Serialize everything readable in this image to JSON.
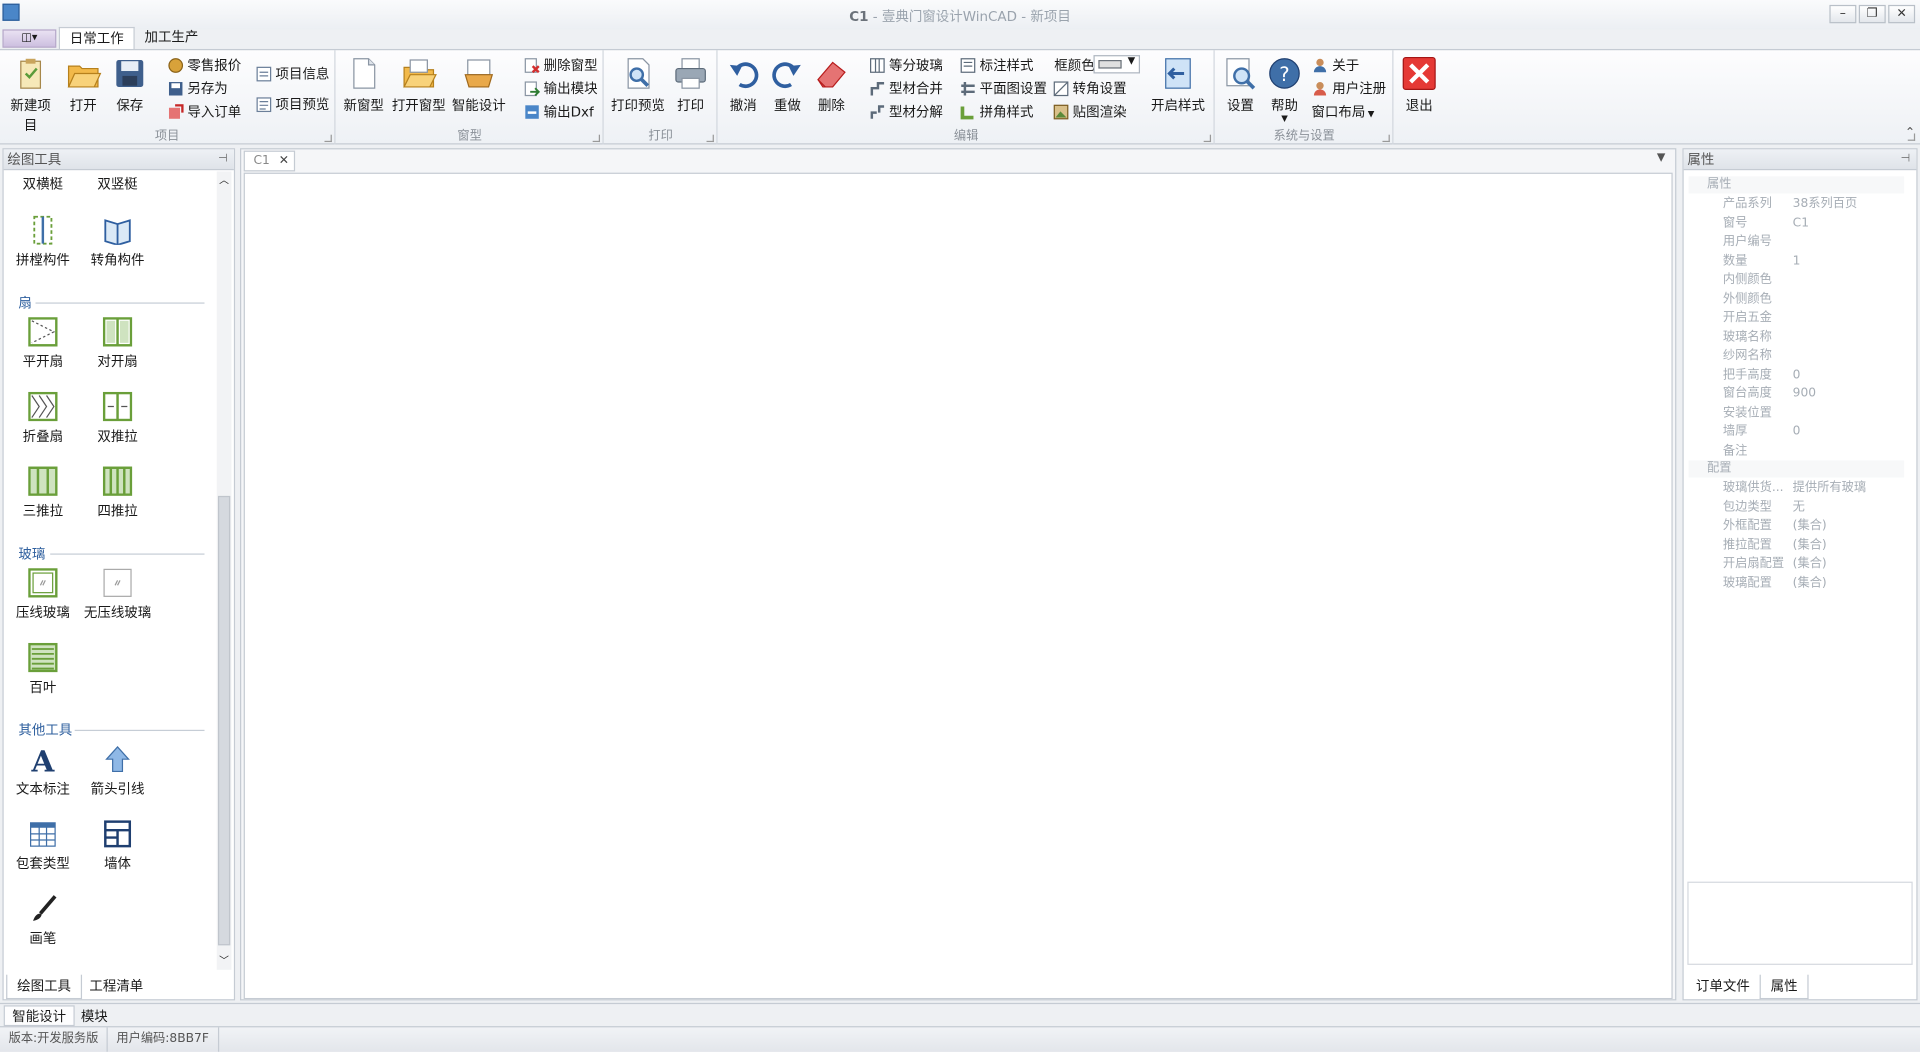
{
  "window": {
    "doc": "C1",
    "title_rest": " - 壹典门窗设计WinCAD - 新项目",
    "min": "–",
    "restore": "❐",
    "close": "✕"
  },
  "app_menu": "◫▾",
  "ribbon_tabs": [
    "日常工作",
    "加工生产"
  ],
  "groups": {
    "project": {
      "label": "项目",
      "new": "新建项目",
      "open": "打开",
      "save": "保存",
      "quote": "零售报价",
      "saveas": "另存为",
      "import": "导入订单",
      "info": "项目信息",
      "preview": "项目预览"
    },
    "window_type": {
      "label": "窗型",
      "new": "新窗型",
      "open": "打开窗型",
      "smart": "智能设计",
      "delete": "删除窗型",
      "export_module": "输出模块",
      "export_dxf": "输出Dxf"
    },
    "print": {
      "label": "打印",
      "preview": "打印预览",
      "print": "打印"
    },
    "edit": {
      "label": "编辑",
      "undo": "撤消",
      "redo": "重做",
      "delete": "删除",
      "glass_split": "等分玻璃",
      "profile_merge": "型材合并",
      "profile_split": "型材分解",
      "dim_style": "标注样式",
      "plan_settings": "平面图设置",
      "corner_style": "拼角样式",
      "frame_color_label": "框颜色",
      "corner_settings": "转角设置",
      "texture_render": "贴图渲染",
      "open_style": "开启样式"
    },
    "system": {
      "label": "系统与设置",
      "settings": "设置",
      "help": "帮助",
      "about": "关于",
      "register": "用户注册",
      "layout": "窗口布局"
    },
    "exit": "退出"
  },
  "left_panel": {
    "title": "绘图工具",
    "top_row": [
      "双横梃",
      "双竖梃"
    ],
    "mullions": [
      "拼樘构件",
      "转角构件"
    ],
    "sash_section": "扇",
    "sash": [
      "平开扇",
      "对开扇",
      "折叠扇",
      "双推拉",
      "三推拉",
      "四推拉"
    ],
    "glass_section": "玻璃",
    "glass": [
      "压线玻璃",
      "无压线玻璃",
      "百叶"
    ],
    "other_section": "其他工具",
    "other": [
      "文本标注",
      "箭头引线",
      "包套类型",
      "墙体",
      "画笔"
    ],
    "tabs": [
      "绘图工具",
      "工程清单"
    ]
  },
  "doc_tab": "C1",
  "right_panel": {
    "title": "属性",
    "cat1": "属性",
    "props1": [
      [
        "产品系列",
        "38系列百页"
      ],
      [
        "窗号",
        "C1"
      ],
      [
        "用户编号",
        ""
      ],
      [
        "数量",
        "1"
      ],
      [
        "内侧颜色",
        ""
      ],
      [
        "外侧颜色",
        ""
      ],
      [
        "开启五金",
        ""
      ],
      [
        "玻璃名称",
        ""
      ],
      [
        "纱网名称",
        ""
      ],
      [
        "把手高度",
        "0"
      ],
      [
        "窗台高度",
        "900"
      ],
      [
        "安装位置",
        ""
      ],
      [
        "墙厚",
        "0"
      ],
      [
        "备注",
        ""
      ]
    ],
    "cat2": "配置",
    "props2": [
      [
        "玻璃供货...",
        "提供所有玻璃"
      ],
      [
        "包边类型",
        "无"
      ],
      [
        "外框配置",
        "(集合)"
      ],
      [
        "推拉配置",
        "(集合)"
      ],
      [
        "开启扇配置",
        "(集合)"
      ],
      [
        "玻璃配置",
        "(集合)"
      ]
    ],
    "tabs": [
      "订单文件",
      "属性"
    ]
  },
  "bottom_tabs": [
    "智能设计",
    "模块"
  ],
  "status": {
    "version": "版本:开发服务版",
    "user_code": "用户编码:8BB7F"
  },
  "colors": {
    "accent": "#4a86c8",
    "exit_red": "#e53935",
    "glyph_green": "#6a9f3a"
  }
}
